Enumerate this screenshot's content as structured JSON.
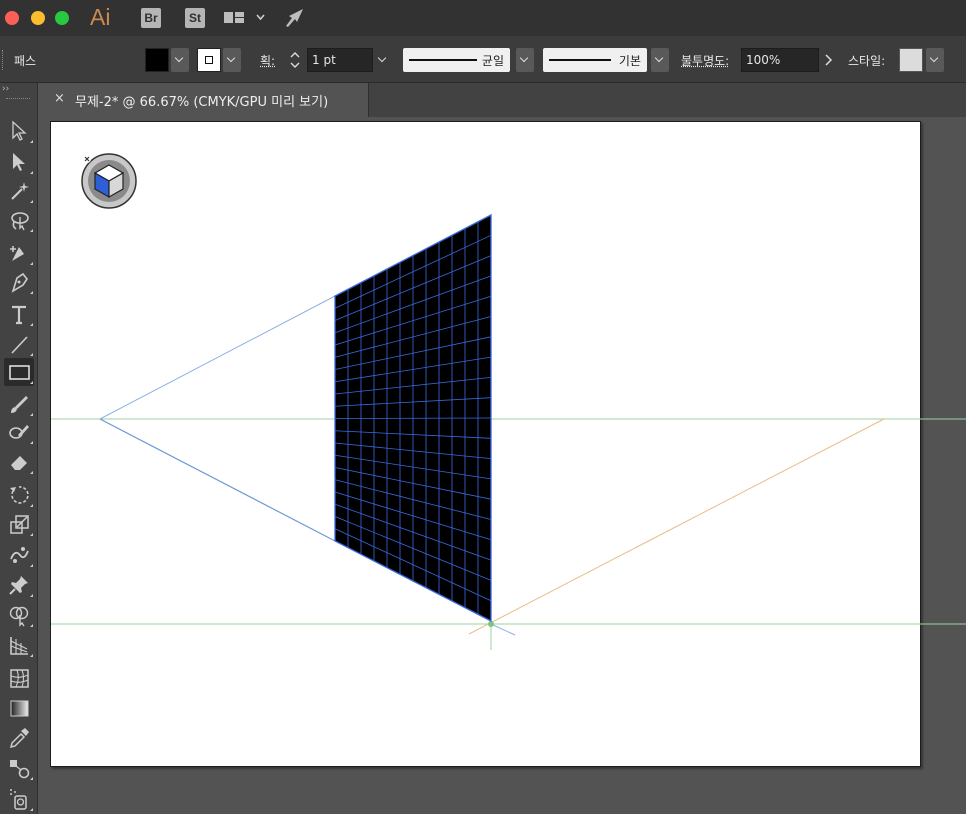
{
  "appbar": {
    "app_logo": "Ai",
    "bridge_label": "Br",
    "stock_label": "St"
  },
  "controlbar": {
    "object_type": "패스",
    "stroke_weight_label": "획:",
    "stroke_weight_value": "1 pt",
    "stroke_profile_label": "균일",
    "brush_label": "기본",
    "opacity_label": "불투명도:",
    "opacity_value": "100%",
    "style_label": "스타일:",
    "fill_color": "#000000",
    "stroke_color": "#ffffff"
  },
  "document_tab": {
    "close_glyph": "×",
    "title": "무제-2* @ 66.67% (CMYK/GPU 미리 보기)"
  },
  "toolbar": {
    "tools": [
      {
        "name": "selection-tool-icon"
      },
      {
        "name": "direct-selection-tool-icon"
      },
      {
        "name": "magic-wand-tool-icon"
      },
      {
        "name": "lasso-tool-icon"
      },
      {
        "name": "curvature-tool-icon"
      },
      {
        "name": "pen-tool-icon"
      },
      {
        "name": "type-tool-icon"
      },
      {
        "name": "line-segment-tool-icon"
      },
      {
        "name": "rectangle-tool-icon",
        "selected": true
      },
      {
        "name": "paintbrush-tool-icon"
      },
      {
        "name": "shaper-tool-icon"
      },
      {
        "name": "eraser-tool-icon"
      },
      {
        "name": "rotate-tool-icon"
      },
      {
        "name": "scale-tool-icon"
      },
      {
        "name": "puppet-warp-tool-icon"
      },
      {
        "name": "pin-tool-icon"
      },
      {
        "name": "shape-builder-tool-icon"
      },
      {
        "name": "perspective-grid-tool-icon"
      },
      {
        "name": "mesh-tool-icon"
      },
      {
        "name": "gradient-tool-icon"
      },
      {
        "name": "eyedropper-tool-icon"
      },
      {
        "name": "blend-tool-icon"
      },
      {
        "name": "symbol-sprayer-tool-icon"
      }
    ]
  },
  "canvas": {
    "horizon_color": "#9fd3a0",
    "left_vanishing_line_color": "#6c9ad8",
    "right_vanishing_line_color": "#e8be8a",
    "plane_fill": "#000000",
    "plane_grid_color": "#3a6ae0",
    "widget_left_face_color": "#2f5fd6"
  }
}
